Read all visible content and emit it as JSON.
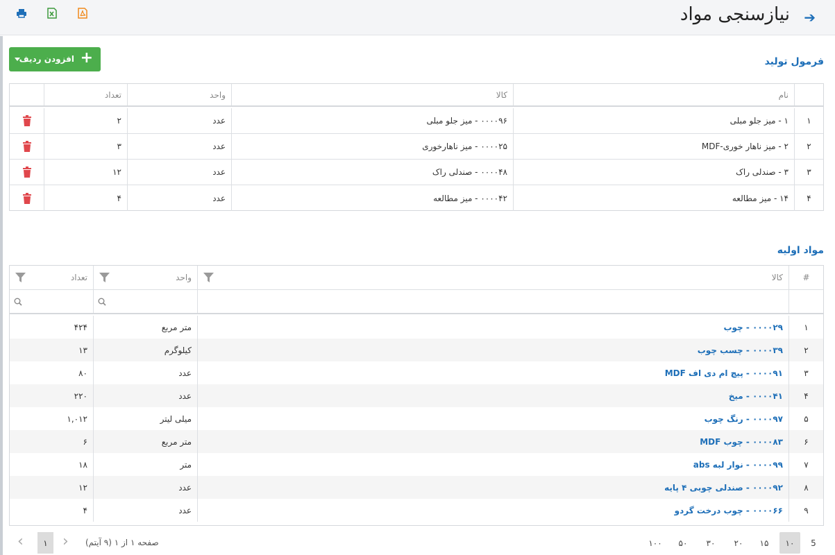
{
  "header": {
    "title": "نیازسنجی مواد",
    "back_icon": "arrow-right-icon",
    "tools": [
      "print-icon",
      "excel-icon",
      "pdf-icon"
    ]
  },
  "formula": {
    "title": "فرمول تولید",
    "add_button": "افزودن ردیف",
    "columns": {
      "name": "نام",
      "kala": "کالا",
      "unit": "واحد",
      "qty": "تعداد"
    },
    "rows": [
      {
        "idx": "۱",
        "name": "۱ - میز جلو مبلی",
        "kala": "۰۰۰۰۹۶ - میز جلو مبلی",
        "unit": "عدد",
        "qty": "۲"
      },
      {
        "idx": "۲",
        "name": "۲ - میز ناهار خوری-MDF",
        "kala": "۰۰۰۰۲۵ - میز ناهارخوری",
        "unit": "عدد",
        "qty": "۳"
      },
      {
        "idx": "۳",
        "name": "۳ - صندلی راک",
        "kala": "۰۰۰۰۴۸ - صندلی راک",
        "unit": "عدد",
        "qty": "۱۲"
      },
      {
        "idx": "۴",
        "name": "۱۴ - میز مطالعه",
        "kala": "۰۰۰۰۴۲ - میز مطالعه",
        "unit": "عدد",
        "qty": "۴"
      }
    ]
  },
  "materials": {
    "title": "مواد اولیه",
    "columns": {
      "idx": "#",
      "kala": "کالا",
      "unit": "واحد",
      "qty": "تعداد"
    },
    "rows": [
      {
        "idx": "۱",
        "kala": "۰۰۰۰۲۹ - چوب",
        "unit": "متر مربع",
        "qty": "۴۲۴"
      },
      {
        "idx": "۲",
        "kala": "۰۰۰۰۳۹ - چسب چوب",
        "unit": "کیلوگرم",
        "qty": "۱۳"
      },
      {
        "idx": "۳",
        "kala": "۰۰۰۰۹۱ - پیچ ام دی اف MDF",
        "unit": "عدد",
        "qty": "۸۰"
      },
      {
        "idx": "۴",
        "kala": "۰۰۰۰۴۱ - میخ",
        "unit": "عدد",
        "qty": "۲۲۰"
      },
      {
        "idx": "۵",
        "kala": "۰۰۰۰۹۷ - رنگ چوب",
        "unit": "میلی لیتر",
        "qty": "۱,۰۱۲"
      },
      {
        "idx": "۶",
        "kala": "۰۰۰۰۸۳ - چوب MDF",
        "unit": "متر مربع",
        "qty": "۶"
      },
      {
        "idx": "۷",
        "kala": "۰۰۰۰۹۹ - نوار لبه abs",
        "unit": "متر",
        "qty": "۱۸"
      },
      {
        "idx": "۸",
        "kala": "۰۰۰۰۹۲ - صندلی چوبی ۴ پایه",
        "unit": "عدد",
        "qty": "۱۲"
      },
      {
        "idx": "۹",
        "kala": "۰۰۰۰۶۶ - چوب درخت گردو",
        "unit": "عدد",
        "qty": "۴"
      }
    ]
  },
  "pager": {
    "sizes": [
      "5",
      "۱۰",
      "۱۵",
      "۲۰",
      "۳۰",
      "۵۰",
      "۱۰۰"
    ],
    "active_size": "۱۰",
    "info": "صفحه ۱ از ۱ (۹ آیتم)",
    "current_page": "۱"
  },
  "colors": {
    "accent": "#1e6fb8",
    "add_button": "#4cae4c",
    "delete": "#e0474c"
  }
}
